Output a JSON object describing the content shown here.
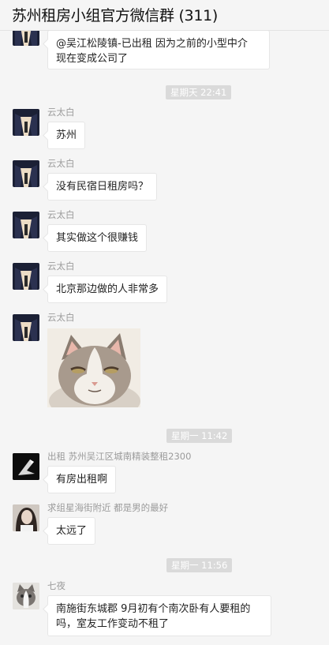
{
  "window": {
    "title": "苏州租房小组官方微信群 (311)"
  },
  "messages": [
    {
      "sender": "",
      "lines": [
        "@吴江松陵镇-已出租 因为之前的小型中介",
        "现在变成公司了"
      ]
    },
    {
      "timestamp": "星期天 22:41"
    },
    {
      "sender": "云太白",
      "lines": [
        "苏州"
      ]
    },
    {
      "sender": "云太白",
      "lines": [
        "没有民宿日租房吗？"
      ]
    },
    {
      "sender": "云太白",
      "lines": [
        "其实做这个很赚钱"
      ]
    },
    {
      "sender": "云太白",
      "lines": [
        "北京那边做的人非常多"
      ]
    },
    {
      "sender": "云太白",
      "sticker": "cat-smug-face-sticker"
    },
    {
      "timestamp": "星期一 11:42"
    },
    {
      "sender": "出租 苏州吴江区城南精装整租2300",
      "lines": [
        "有房出租啊"
      ]
    },
    {
      "sender": "求组星海街附近 都是男的最好",
      "lines": [
        "太远了"
      ]
    },
    {
      "timestamp": "星期一 11:56"
    },
    {
      "sender": "七夜",
      "lines": [
        "南施街东城郡 9月初有个南次卧有人要租的",
        "吗，室友工作变动不租了"
      ]
    }
  ],
  "colors": {
    "background": "#f5f5f5",
    "bubble": "#ffffff",
    "timestamp_bg": "#dadada",
    "sender_text": "#9b9b9b"
  }
}
